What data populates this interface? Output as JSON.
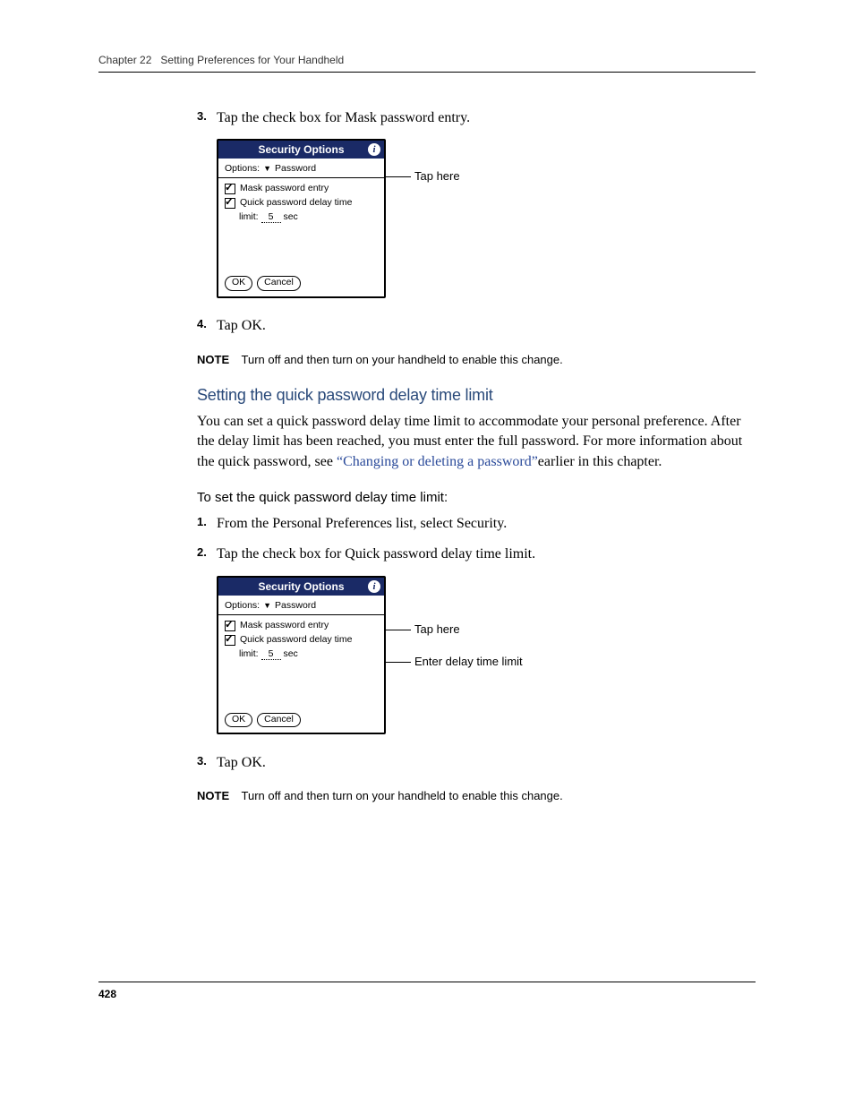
{
  "header": {
    "chapter": "Chapter 22",
    "title": "Setting Preferences for Your Handheld"
  },
  "sectionA": {
    "step3": {
      "num": "3.",
      "text": "Tap the check box for Mask password entry."
    },
    "dialog": {
      "title": "Security Options",
      "optionsLabel": "Options:",
      "optionsValue": "Password",
      "maskLabel": "Mask password entry",
      "quickLabel": "Quick password delay time",
      "limitPrefix": "limit:",
      "limitValue": "5",
      "limitSuffix": "sec",
      "ok": "OK",
      "cancel": "Cancel"
    },
    "callout1": "Tap here",
    "step4": {
      "num": "4.",
      "text": "Tap OK."
    },
    "note": {
      "label": "NOTE",
      "text": "Turn off and then turn on your handheld to enable this change."
    }
  },
  "sectionB": {
    "heading": "Setting the quick password delay time limit",
    "paraPrefix": "You can set a quick password delay time limit to accommodate your personal preference. After the delay limit has been reached, you must enter the full password. For more information about the quick password, see ",
    "link": "“Changing or deleting a password”",
    "paraSuffix": "earlier in this chapter.",
    "subheading": "To set the quick password delay time limit:",
    "step1": {
      "num": "1.",
      "text": "From the Personal Preferences list, select Security."
    },
    "step2": {
      "num": "2.",
      "text": "Tap the check box for Quick password delay time limit."
    },
    "dialog": {
      "title": "Security Options",
      "optionsLabel": "Options:",
      "optionsValue": "Password",
      "maskLabel": "Mask password entry",
      "quickLabel": "Quick password delay time",
      "limitPrefix": "limit:",
      "limitValue": "5",
      "limitSuffix": "sec",
      "ok": "OK",
      "cancel": "Cancel"
    },
    "callout1": "Tap here",
    "callout2": "Enter delay time limit",
    "step3": {
      "num": "3.",
      "text": "Tap OK."
    },
    "note": {
      "label": "NOTE",
      "text": "Turn off and then turn on your handheld to enable this change."
    }
  },
  "pageNumber": "428"
}
